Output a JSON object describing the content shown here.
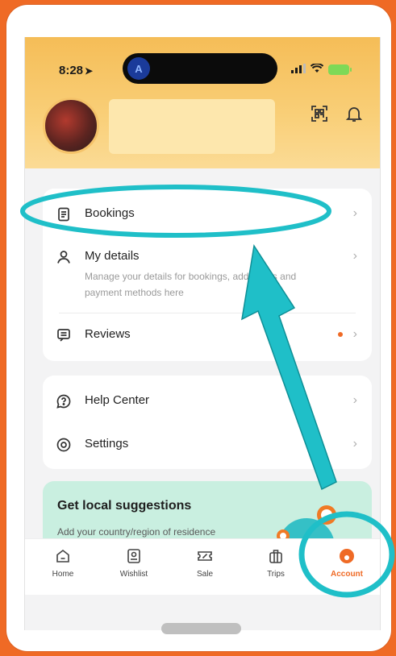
{
  "status": {
    "time": "8:28",
    "nav_glyph": "A",
    "signal_icon": "signal-icon",
    "wifi_icon": "wifi-icon",
    "battery_icon": "battery-charging-icon"
  },
  "header": {
    "qr_icon": "qr-code-icon",
    "bell_icon": "bell-icon"
  },
  "card1": {
    "rows": [
      {
        "label": "Bookings",
        "icon": "document-icon"
      },
      {
        "label": "My details",
        "sub": "Manage your details for bookings, addresses and payment methods here",
        "icon": "person-icon"
      },
      {
        "label": "Reviews",
        "icon": "message-icon",
        "badge": "new-dot"
      }
    ]
  },
  "card2": {
    "rows": [
      {
        "label": "Help Center",
        "icon": "help-icon"
      },
      {
        "label": "Settings",
        "icon": "settings-icon"
      }
    ]
  },
  "promo": {
    "title": "Get local suggestions",
    "desc": "Add your country/region of residence"
  },
  "tabbar": {
    "tabs": [
      {
        "label": "Home",
        "icon": "home-icon"
      },
      {
        "label": "Wishlist",
        "icon": "wishlist-icon"
      },
      {
        "label": "Sale",
        "icon": "sale-ticket-icon"
      },
      {
        "label": "Trips",
        "icon": "luggage-icon"
      },
      {
        "label": "Account",
        "icon": "account-icon",
        "active": true
      }
    ]
  },
  "colors": {
    "accent": "#ef6a25",
    "annotation": "#1fbfc8",
    "header": "#f7c566",
    "promo": "#c9efe0"
  }
}
